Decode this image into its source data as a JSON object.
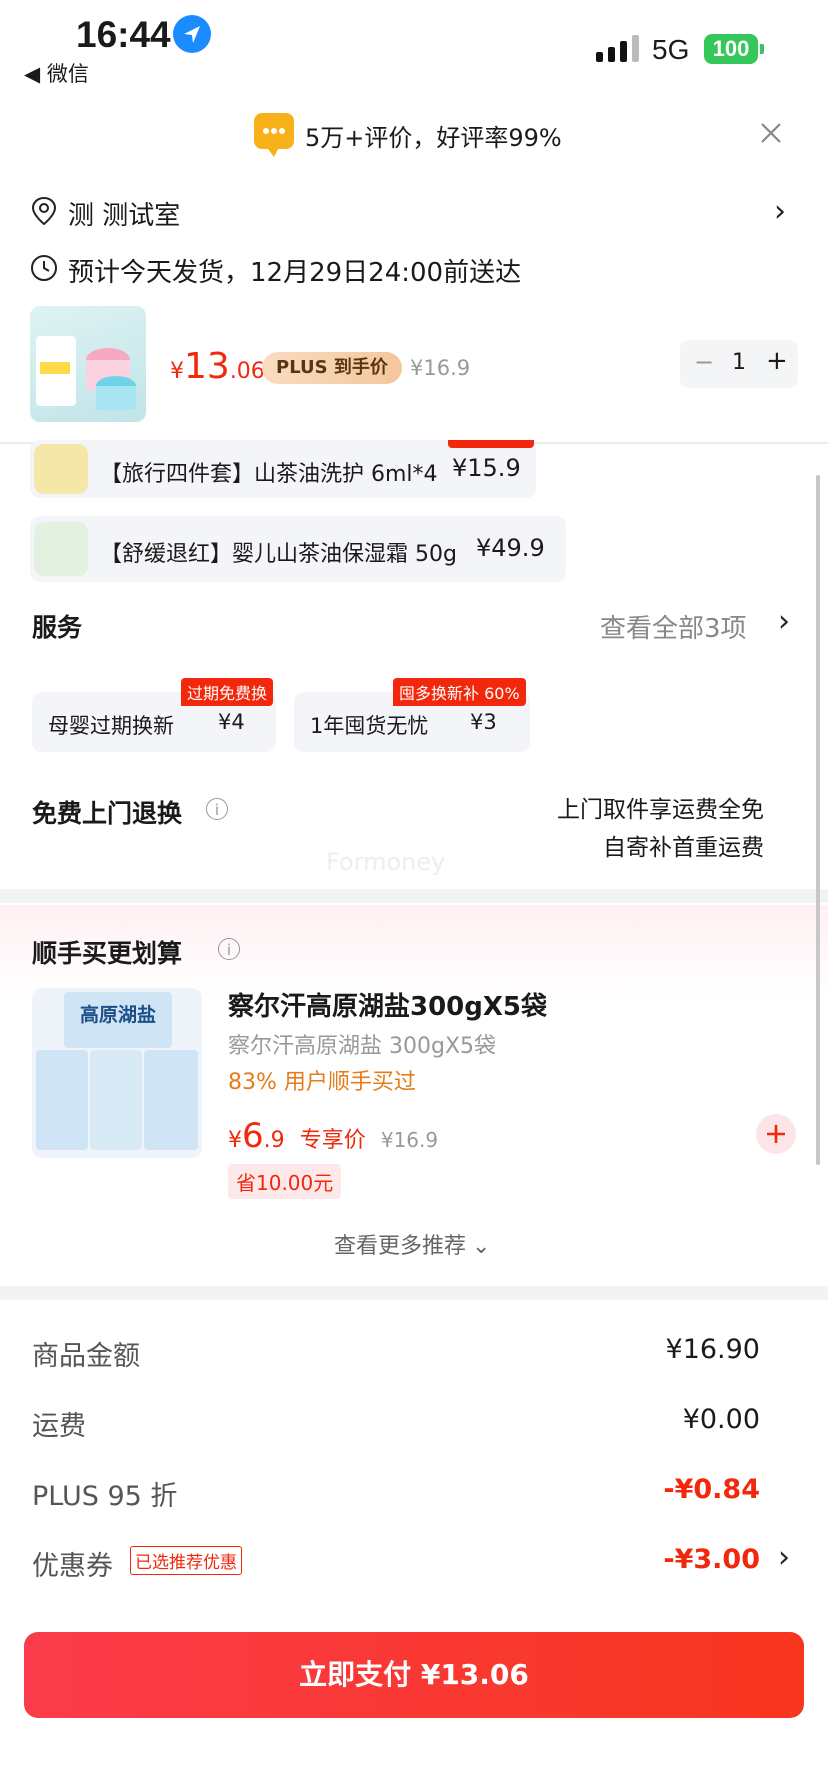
{
  "status_bar": {
    "time": "16:44",
    "back_app": "◀ 微信",
    "network": "5G",
    "battery": "100"
  },
  "banner": {
    "text": "5万+评价，好评率99%"
  },
  "address": {
    "label": "测 测试室"
  },
  "delivery": {
    "text": "预计今天发货，12月29日24:00前送达"
  },
  "product": {
    "currency": "¥",
    "price_int": "13",
    "price_dec": ".06",
    "plus_label": "PLUS 到手价",
    "orig_price": "¥16.9",
    "quantity": "1",
    "minus": "−",
    "plus": "+"
  },
  "gifts": [
    {
      "name": "【旅行四件套】山茶油洗护 6ml*4",
      "price": "¥15.9"
    },
    {
      "name": "【舒缓退红】婴儿山茶油保湿霜 50g",
      "price": "¥49.9"
    }
  ],
  "service": {
    "title": "服务",
    "view_all": "查看全部3项",
    "cards": [
      {
        "name": "母婴过期换新",
        "price": "¥4",
        "tag": "过期免费换"
      },
      {
        "name": "1年囤货无忧",
        "price": "¥3",
        "tag": "囤多换新补 60%"
      }
    ]
  },
  "return_service": {
    "title": "免费上门退换",
    "line1": "上门取件享运费全免",
    "line2": "自寄补首重运费"
  },
  "watermark": "Formoney",
  "recommend": {
    "title": "顺手买更划算",
    "item": {
      "title": "察尔汗高原湖盐300gX5袋",
      "subtitle": "察尔汗高原湖盐 300gX5袋",
      "social": "83% 用户顺手买过",
      "currency": "¥",
      "price_int": "6",
      "price_dec": ".9",
      "price_label": "专享价",
      "orig_price": "¥16.9",
      "save": "省10.00元",
      "pack_label": "高原湖盐"
    },
    "more": "查看更多推荐"
  },
  "summary": [
    {
      "label": "商品金额",
      "value": "¥16.90",
      "red": false
    },
    {
      "label": "运费",
      "value": "¥0.00",
      "red": false
    },
    {
      "label": "PLUS 95 折",
      "value": "-¥0.84",
      "red": true
    },
    {
      "label": "优惠券",
      "value": "-¥3.00",
      "red": true,
      "badge": "已选推荐优惠"
    }
  ],
  "pay_button": "立即支付 ¥13.06",
  "colors": {
    "accent": "#f2270c",
    "plus_gold": "#f3c79d",
    "battery": "#35c759"
  }
}
